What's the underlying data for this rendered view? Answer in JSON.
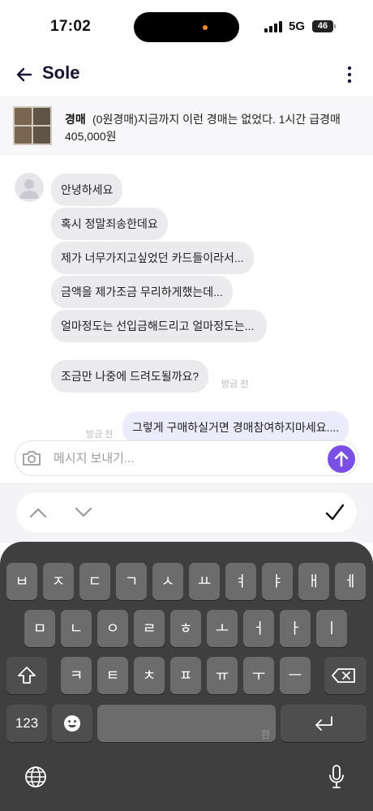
{
  "status": {
    "time": "17:02",
    "network": "5G",
    "battery": "46"
  },
  "header": {
    "title": "Sole"
  },
  "item": {
    "kind": "경매",
    "title": "(0원경매)지금까지 이런 경매는 없었다. 1시간 급경매",
    "price": "405,000원"
  },
  "messages": {
    "incoming": [
      "안녕하세요",
      "혹시 정말죄송한데요",
      "제가 너무가지고싶었던 카드들이라서...",
      "금액을 제가조금 무리하게했는데...",
      "얼마정도는 선입금해드리고 얼마정도는...",
      "조금만 나중에 드려도될까요?"
    ],
    "incoming_time": "방금 전",
    "outgoing": [
      "그렇게 구매하실거면 경매참여하지마세요...."
    ],
    "outgoing_time": "방금 전"
  },
  "composer": {
    "placeholder": "메시지 보내기..."
  },
  "keyboard": {
    "row1": [
      "ㅂ",
      "ㅈ",
      "ㄷ",
      "ㄱ",
      "ㅅ",
      "ㅛ",
      "ㅕ",
      "ㅑ",
      "ㅐ",
      "ㅔ"
    ],
    "row2": [
      "ㅁ",
      "ㄴ",
      "ㅇ",
      "ㄹ",
      "ㅎ",
      "ㅗ",
      "ㅓ",
      "ㅏ",
      "ㅣ"
    ],
    "row3": [
      "ㅋ",
      "ㅌ",
      "ㅊ",
      "ㅍ",
      "ㅠ",
      "ㅜ",
      "ㅡ"
    ],
    "numbers_label": "123",
    "space_hint": "한"
  },
  "colors": {
    "accent": "#7b4fe6",
    "keyboard_bg": "#3f3f3f",
    "key": "#6c6c6c"
  }
}
